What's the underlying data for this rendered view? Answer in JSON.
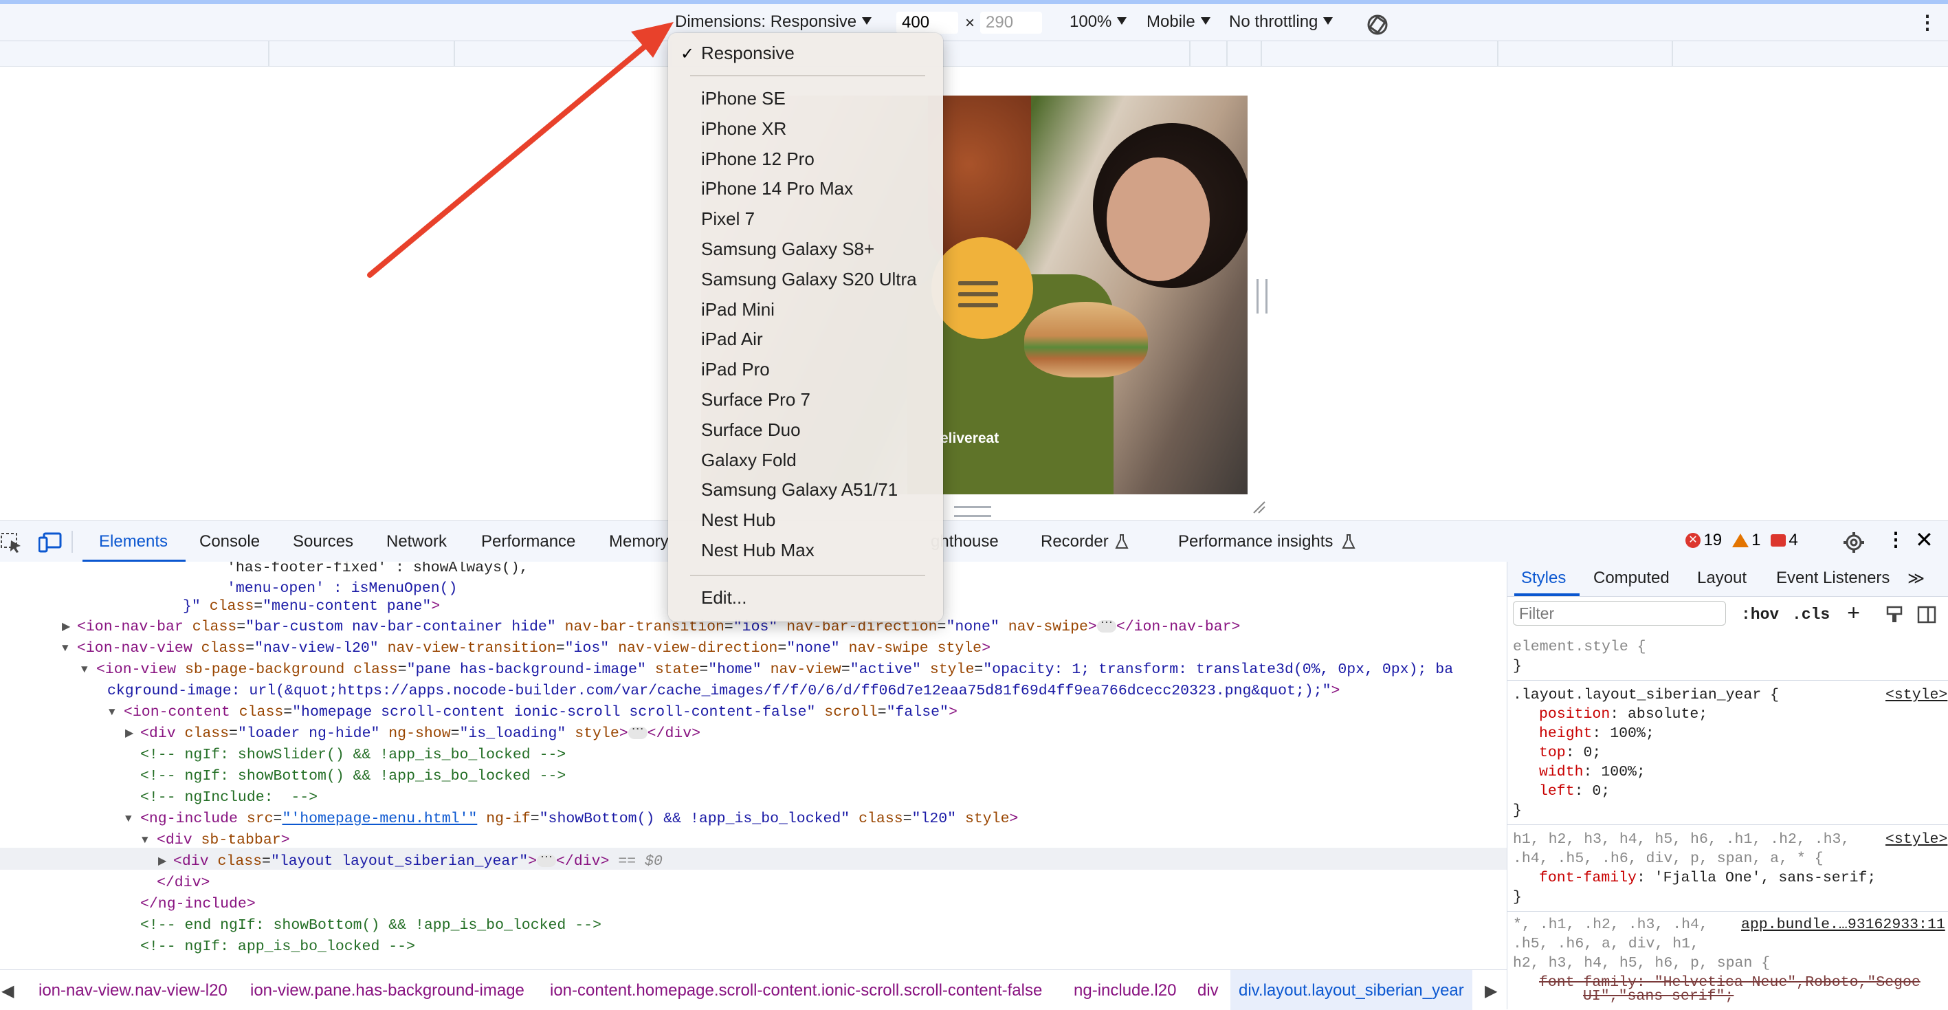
{
  "device_toolbar": {
    "dimensions_label": "Dimensions: Responsive",
    "width": "400",
    "height_placeholder": "290",
    "times": "×",
    "zoom": "100%",
    "mode": "Mobile",
    "throttling": "No throttling",
    "rotate_icon": "rotate-icon",
    "more_icon": "⋮"
  },
  "viewport": {
    "brand_text": "elivereat"
  },
  "dropdown": {
    "checkmark": "✓",
    "selected": "Responsive",
    "devices": [
      "iPhone SE",
      "iPhone XR",
      "iPhone 12 Pro",
      "iPhone 14 Pro Max",
      "Pixel 7",
      "Samsung Galaxy S8+",
      "Samsung Galaxy S20 Ultra",
      "iPad Mini",
      "iPad Air",
      "iPad Pro",
      "Surface Pro 7",
      "Surface Duo",
      "Galaxy Fold",
      "Samsung Galaxy A51/71",
      "Nest Hub",
      "Nest Hub Max"
    ],
    "edit": "Edit..."
  },
  "devtools": {
    "tabs": [
      "Elements",
      "Console",
      "Sources",
      "Network",
      "Performance",
      "Memory",
      "ghthouse",
      "Recorder",
      "Performance insights"
    ],
    "errors": "19",
    "warnings": "1",
    "issues": "4"
  },
  "elements_lines": [
    {
      "indent": 330,
      "html": [
        [
          "txt",
          "'has-footer-fixed' : showAlways(),"
        ]
      ]
    },
    {
      "indent": 330,
      "html": [
        [
          "val",
          "'menu-open' : isMenuOpen()"
        ]
      ]
    },
    {
      "indent": 266,
      "html": [
        [
          "val",
          "}\""
        ],
        [
          "attr",
          " class"
        ],
        [
          "txt",
          "="
        ],
        [
          "val",
          "\"menu-content pane\""
        ],
        [
          "tag",
          ">"
        ]
      ]
    }
  ],
  "styles": {
    "tabs": [
      "Styles",
      "Computed",
      "Layout",
      "Event Listeners"
    ],
    "filter_placeholder": "Filter",
    "hov": ":hov",
    "cls": ".cls",
    "element_style": "element.style {",
    "close_brace": "}",
    "rule1_selector": ".layout.layout_siberian_year {",
    "rule1_source": "<style>",
    "rule1_props": [
      [
        "position",
        "absolute;"
      ],
      [
        "height",
        "100%;"
      ],
      [
        "top",
        "0;"
      ],
      [
        "width",
        "100%;"
      ],
      [
        "left",
        "0;"
      ]
    ],
    "rule2_selector_a": "h1, h2, h3, h4, h5, h6, .h1, .h2, .h3,",
    "rule2_selector_b": ".h4, .h5, .h6, div, p, span, a, * {",
    "rule2_source": "<style>",
    "rule2_prop": [
      "font-family",
      "'Fjalla One', sans-serif;"
    ],
    "rule3_selector_a": "*, .h1, .h2, .h3, .h4,",
    "rule3_selector_b": ".h5, .h6, a, div, h1,",
    "rule3_selector_c": "h2, h3, h4, h5, h6, p, span {",
    "rule3_source": "app.bundle.…93162933:11",
    "rule3_prop": "font-family: \"Helvetica Neue\",Roboto,\"Segoe",
    "rule3_prop_b": "UI\",\"sans-serif\";"
  },
  "breadcrumbs": [
    "ion-nav-view.nav-view-l20",
    "ion-view.pane.has-background-image",
    "ion-content.homepage.scroll-content.ionic-scroll.scroll-content-false",
    "ng-include.l20",
    "div",
    "div.layout.layout_siberian_year"
  ]
}
